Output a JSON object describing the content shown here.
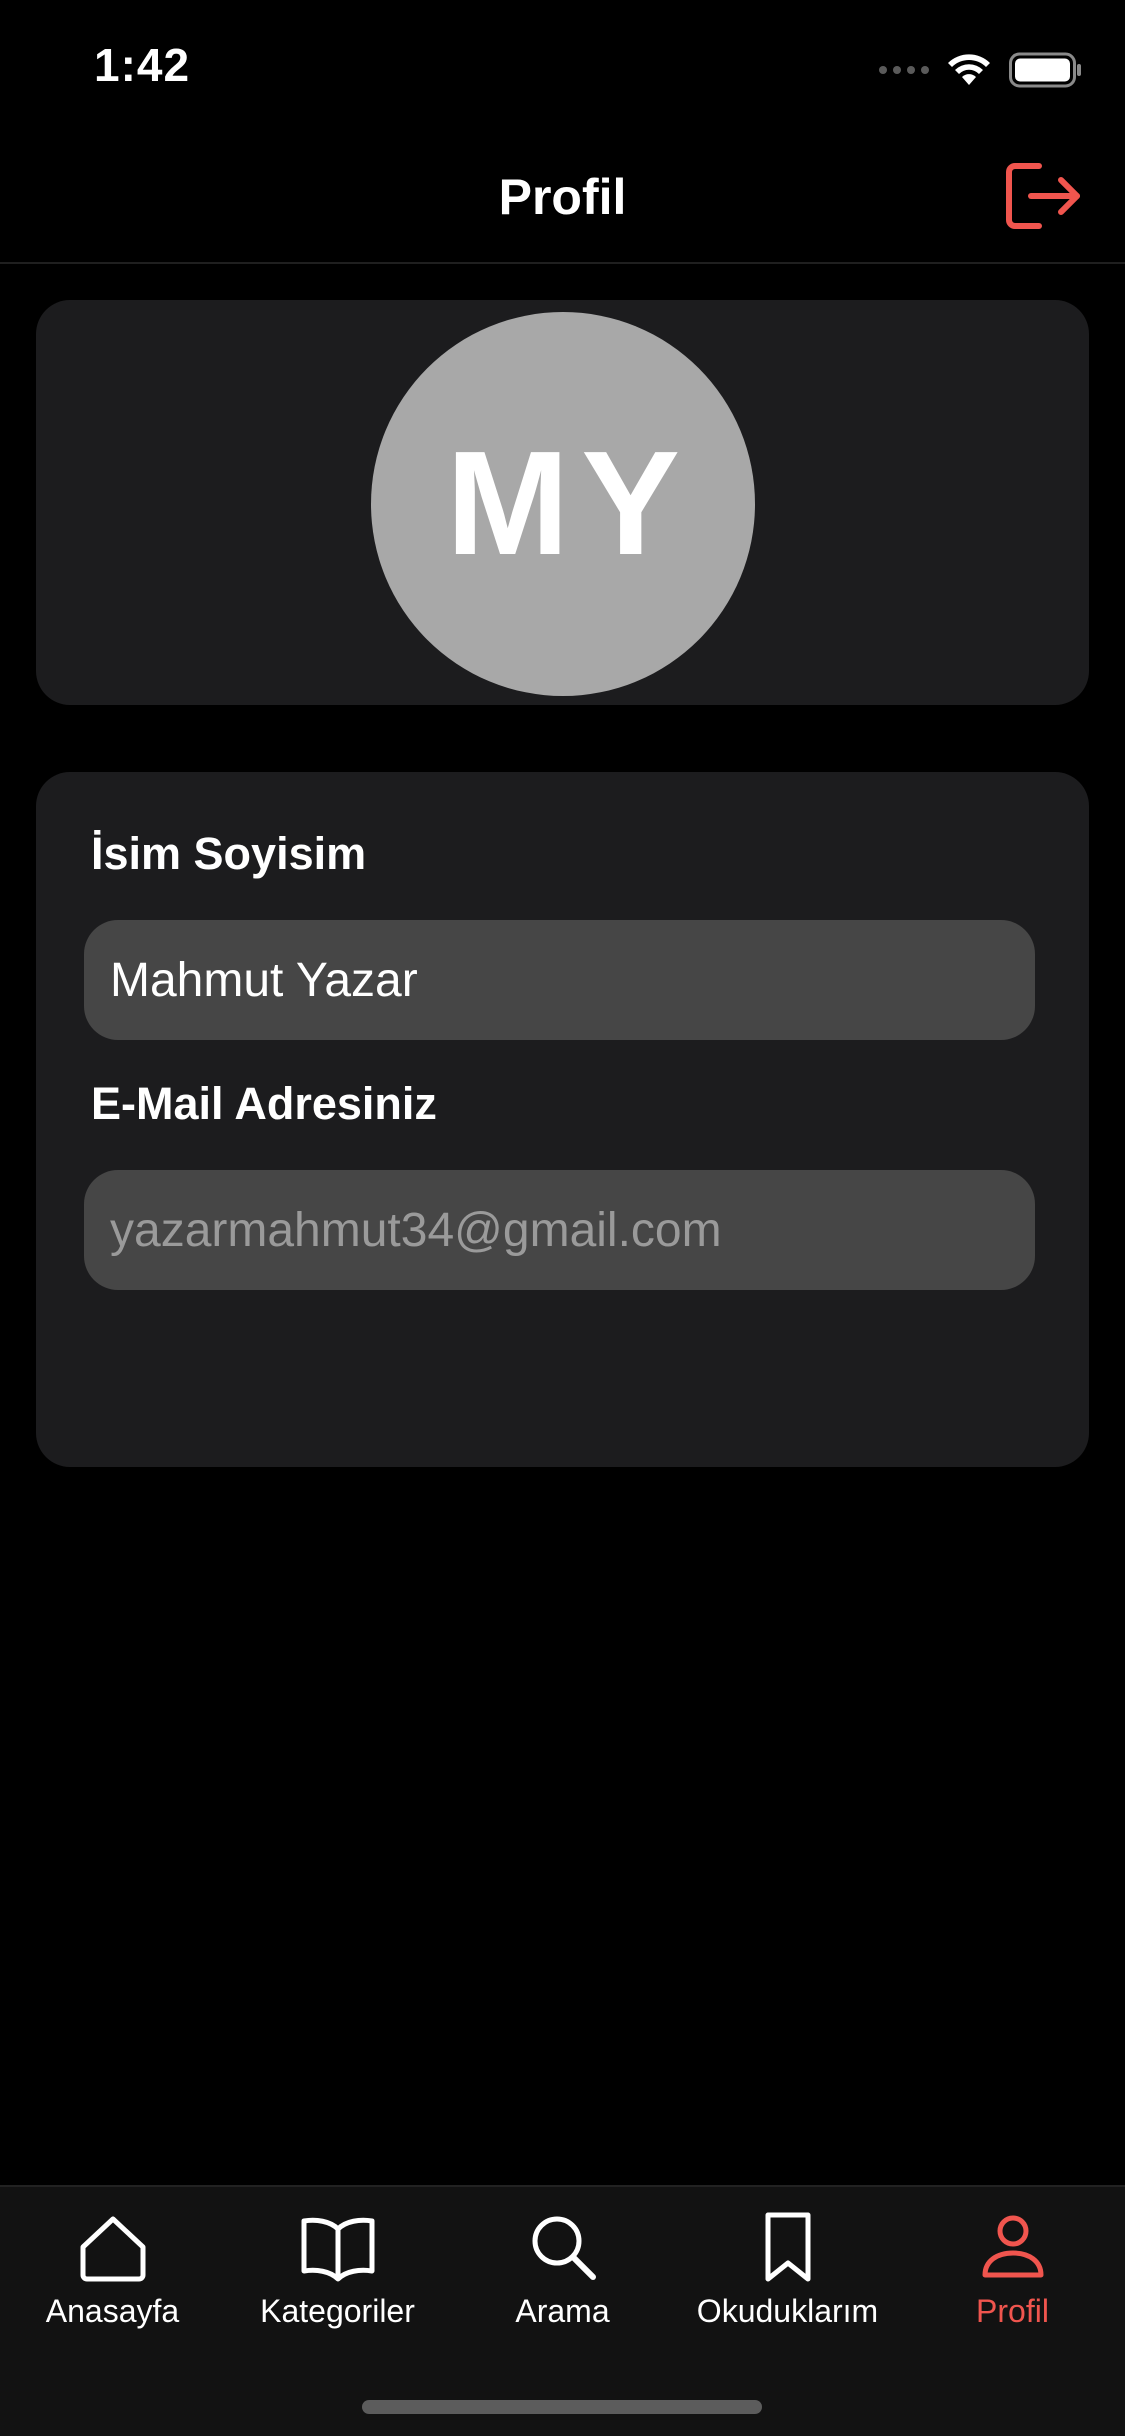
{
  "status_bar": {
    "time": "1:42"
  },
  "nav": {
    "title": "Profil",
    "logout_icon": "logout-icon"
  },
  "profile": {
    "initials": "MY"
  },
  "form": {
    "name_label": "İsim Soyisim",
    "name_value": "Mahmut Yazar",
    "email_label": "E-Mail Adresiniz",
    "email_value": "yazarmahmut34@gmail.com"
  },
  "tabs": [
    {
      "label": "Anasayfa",
      "icon": "home-icon",
      "active": false
    },
    {
      "label": "Kategoriler",
      "icon": "book-icon",
      "active": false
    },
    {
      "label": "Arama",
      "icon": "search-icon",
      "active": false
    },
    {
      "label": "Okuduklarım",
      "icon": "bookmark-icon",
      "active": false
    },
    {
      "label": "Profil",
      "icon": "person-icon",
      "active": true
    }
  ],
  "colors": {
    "accent": "#f0554e",
    "background": "#000000",
    "card": "#1c1c1e",
    "input": "#464646",
    "avatar": "#a8a8a8"
  }
}
